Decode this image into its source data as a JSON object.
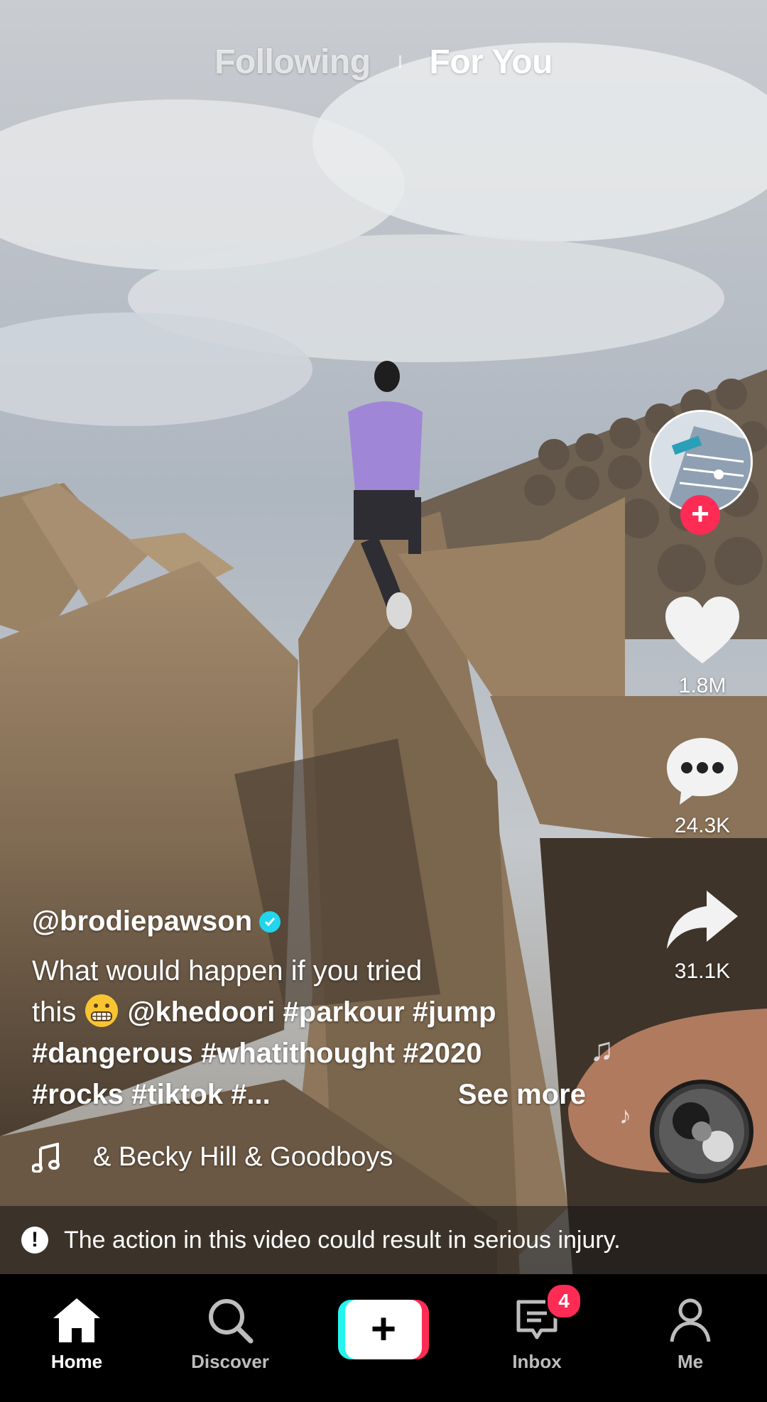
{
  "top_tabs": {
    "following": "Following",
    "for_you": "For You",
    "active": "For You"
  },
  "creator": {
    "username": "@brodiepawson",
    "verified": true
  },
  "actions": {
    "likes": "1.8M",
    "comments": "24.3K",
    "shares": "31.1K"
  },
  "caption": {
    "line1": "What would happen if you tried",
    "line2_prefix": "this",
    "line2_rest": "@khedoori #parkour #jump",
    "line3": "#dangerous #whatithought #2020",
    "line4": "#rocks #tiktok #...",
    "see_more": "See more"
  },
  "music": {
    "title": "& Becky Hill & Goodboys"
  },
  "warning": {
    "text": "The action in this video could result in serious injury."
  },
  "bottom_nav": {
    "home": "Home",
    "discover": "Discover",
    "inbox": "Inbox",
    "inbox_badge": "4",
    "me": "Me"
  },
  "colors": {
    "accent": "#fe2c55",
    "cyan": "#25f4ee",
    "verified": "#20d5ec"
  }
}
